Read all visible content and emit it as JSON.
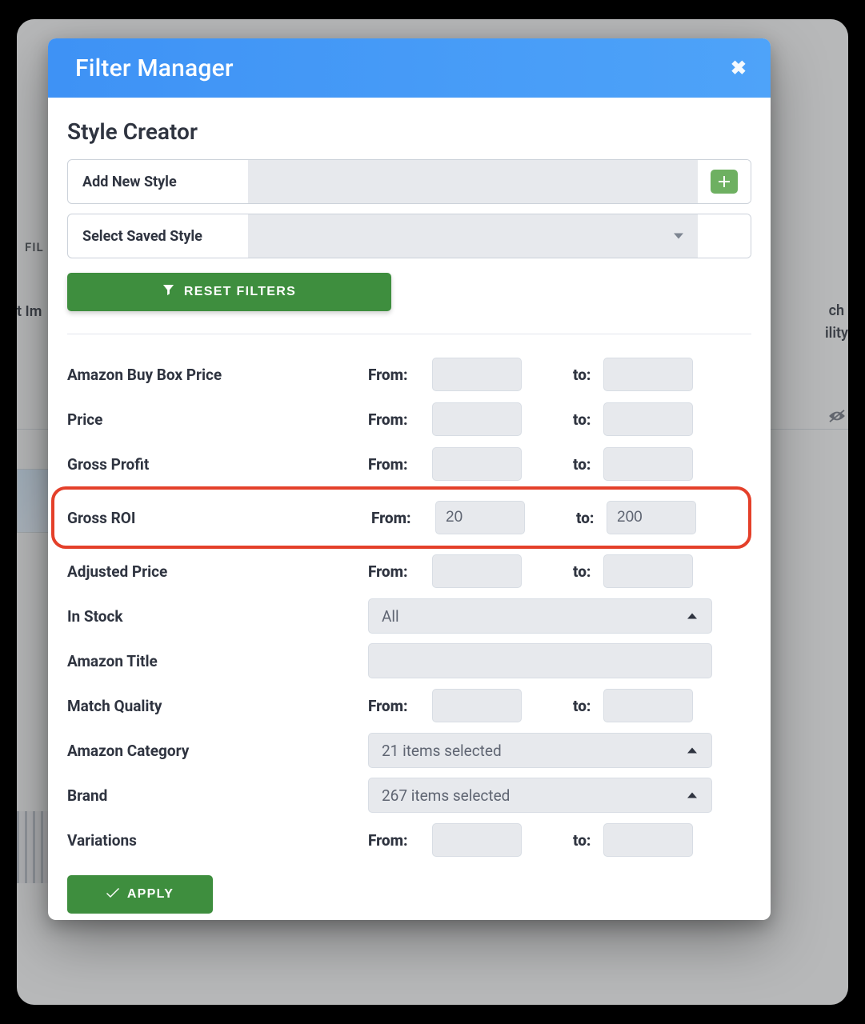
{
  "modal": {
    "title": "Filter Manager",
    "section_title": "Style Creator",
    "add_new_style_label": "Add New Style",
    "select_saved_style_label": "Select Saved Style",
    "reset_label": "RESET FILTERS",
    "apply_label": "APPLY"
  },
  "bg": {
    "fil": "FIL",
    "t_im": "t Im",
    "ch": "ch",
    "ility": "ility"
  },
  "labels": {
    "from": "From:",
    "to": "to:"
  },
  "filters": {
    "amazon_buy_box_price": {
      "label": "Amazon Buy Box Price",
      "from": "",
      "to": ""
    },
    "price": {
      "label": "Price",
      "from": "",
      "to": ""
    },
    "gross_profit": {
      "label": "Gross Profit",
      "from": "",
      "to": ""
    },
    "gross_roi": {
      "label": "Gross ROI",
      "from": "20",
      "to": "200",
      "highlight": true
    },
    "adjusted_price": {
      "label": "Adjusted Price",
      "from": "",
      "to": ""
    },
    "in_stock": {
      "label": "In Stock",
      "selected": "All"
    },
    "amazon_title": {
      "label": "Amazon Title",
      "value": ""
    },
    "match_quality": {
      "label": "Match Quality",
      "from": "",
      "to": ""
    },
    "amazon_category": {
      "label": "Amazon Category",
      "selected": "21 items selected"
    },
    "brand": {
      "label": "Brand",
      "selected": "267 items selected"
    },
    "variations": {
      "label": "Variations",
      "from": "",
      "to": ""
    }
  }
}
